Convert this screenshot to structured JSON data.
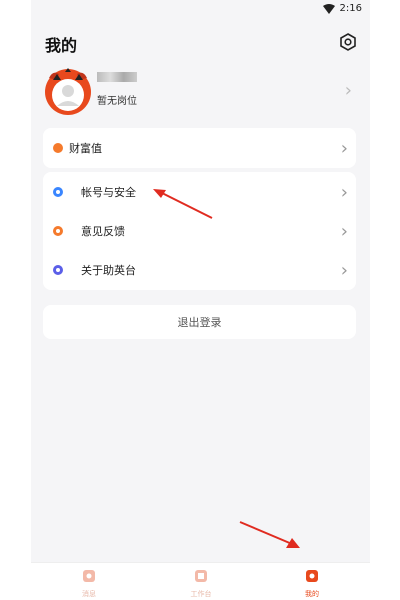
{
  "status": {
    "time": "2:16"
  },
  "header": {
    "title": "我的"
  },
  "profile": {
    "name": "",
    "position": "暂无岗位"
  },
  "menu": {
    "wealth_label": "财富值",
    "items": [
      {
        "label": "帐号与安全",
        "icon": "shield-dot-icon",
        "color": "#3a86ff"
      },
      {
        "label": "意见反馈",
        "icon": "feedback-dot-icon",
        "color": "#f57a2c"
      },
      {
        "label": "关于助英台",
        "icon": "info-dot-icon",
        "color": "#5b5fe8"
      }
    ]
  },
  "logout": {
    "label": "退出登录"
  },
  "tabs": [
    {
      "label": "消息",
      "icon": "message-icon",
      "active": false
    },
    {
      "label": "工作台",
      "icon": "workbench-icon",
      "active": false
    },
    {
      "label": "我的",
      "icon": "profile-icon",
      "active": true
    }
  ],
  "colors": {
    "accent": "#e8491d",
    "wealth_dot": "#f57a2c",
    "annotation_arrow": "#e02b20"
  }
}
